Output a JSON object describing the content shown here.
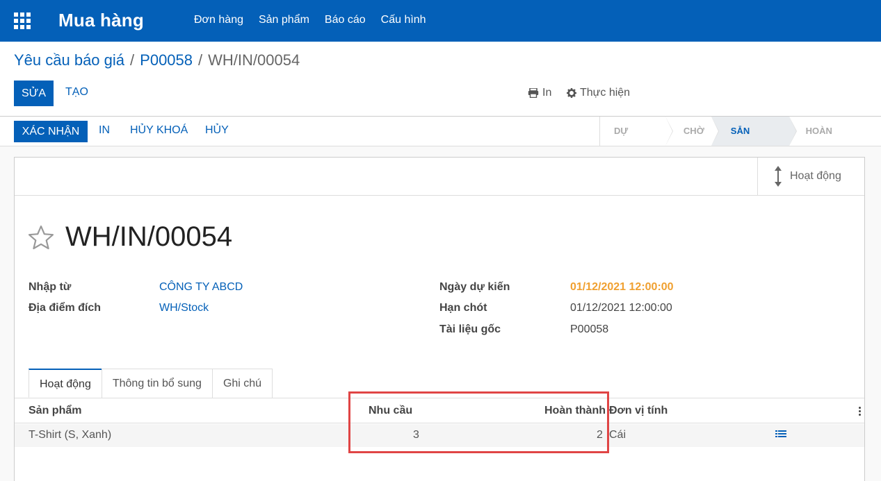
{
  "navbar": {
    "apps_icon": "apps-grid-icon",
    "brand": "Mua hàng",
    "menu": [
      "Đơn hàng",
      "Sản phẩm",
      "Báo cáo",
      "Cấu hình"
    ],
    "color": "#0460b8"
  },
  "breadcrumb": {
    "items": [
      "Yêu cầu báo giá",
      "P00058"
    ],
    "current": "WH/IN/00054",
    "separator": "/"
  },
  "buttons": {
    "edit": "Sửa",
    "create": "Tạo"
  },
  "actions": {
    "print": "In",
    "print_icon": "print-icon",
    "execute": "Thực hiện",
    "execute_icon": "gear-icon"
  },
  "statusbar": {
    "confirm": "Xác nhận",
    "links": [
      "In",
      "Hủy khoá",
      "Hủy"
    ],
    "stages": [
      "Dự thảo",
      "Chờ",
      "Sẵn sàng",
      "Hoàn thành"
    ],
    "active_stage": "Sẵn sàng"
  },
  "sheet": {
    "smart_button": "Hoạt động",
    "smart_button_icon": "arrows-vertical-icon",
    "title": "WH/IN/00054",
    "star_icon": "star-outline-icon",
    "fields_left": [
      {
        "label": "Nhập từ",
        "value": "CÔNG TY ABCD"
      },
      {
        "label": "Địa điểm đích",
        "value": "WH/Stock"
      }
    ],
    "fields_right": [
      {
        "label": "Ngày dự kiến",
        "value": "01/12/2021 12:00:00"
      },
      {
        "label": "Hạn chót",
        "value": "01/12/2021 12:00:00"
      },
      {
        "label": "Tài liệu gốc",
        "value": "P00058"
      }
    ],
    "warning_color": "#f0a030"
  },
  "tabs": [
    "Hoạt động",
    "Thông tin bổ sung",
    "Ghi chú"
  ],
  "table": {
    "columns": [
      "Sản phẩm",
      "Nhu cầu",
      "Hoàn thành",
      "Đơn vị tính"
    ],
    "rows": [
      {
        "product": "T-Shirt (S, Xanh)",
        "demand": "3",
        "done": "2",
        "uom": "Cái"
      }
    ],
    "row_icon": "list-detail-icon",
    "options_icon": "kebab-menu-icon"
  },
  "highlight_color": "#e04545"
}
